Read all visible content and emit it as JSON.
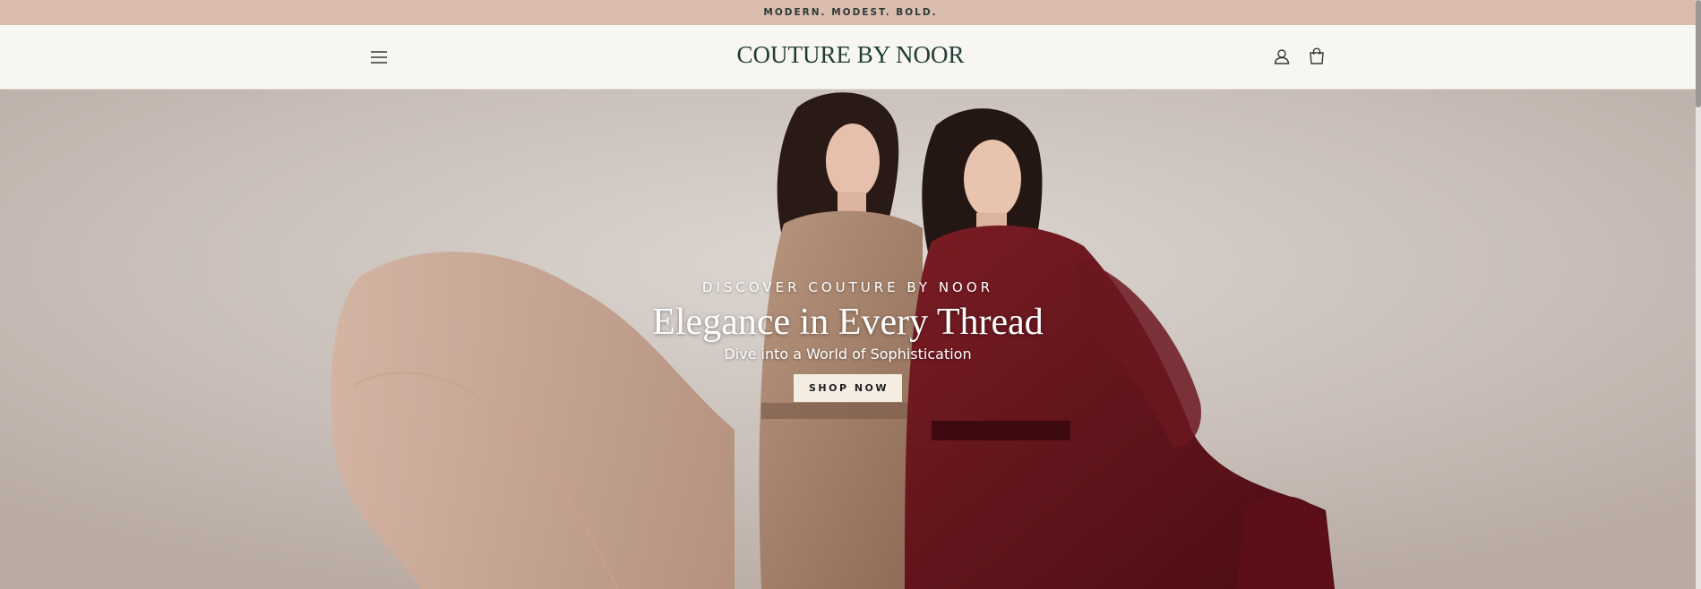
{
  "announcement": {
    "text": "MODERN. MODEST. BOLD."
  },
  "header": {
    "logo": "COUTURE BY NOOR",
    "icons": {
      "menu": "hamburger-menu-icon",
      "account": "user-icon",
      "cart": "shopping-bag-icon"
    }
  },
  "hero": {
    "eyebrow": "DISCOVER COUTURE BY NOOR",
    "title": "Elegance in Every Thread",
    "subtitle": "Dive into a World of Sophistication",
    "cta_label": "SHOP NOW"
  },
  "colors": {
    "announcement_bg": "#dbbdae",
    "header_bg": "#f8f6f1",
    "logo": "#1f3c36",
    "cta_bg": "#f5ede2"
  }
}
